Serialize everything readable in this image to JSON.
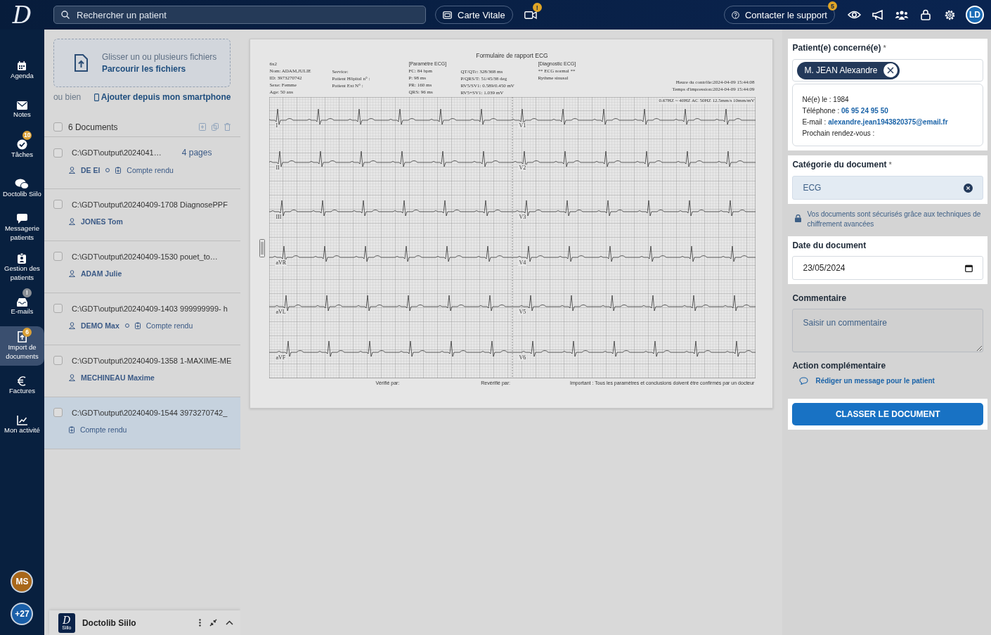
{
  "top_bar": {
    "logo": "D",
    "search": {
      "placeholder": "Rechercher un patient"
    },
    "carte_vitale": "Carte Vitale",
    "video_badge": "!",
    "support": {
      "label": "Contacter le support",
      "badge": "5"
    },
    "avatar": "LD"
  },
  "sidebar": {
    "items": [
      {
        "label": "Agenda",
        "selected": false
      },
      {
        "label": "Notes",
        "selected": false
      },
      {
        "label": "Tâches",
        "badge": "10",
        "selected": false
      },
      {
        "label": "Doctolib Siilo",
        "selected": false
      },
      {
        "label": "Messagerie patients",
        "selected": false
      },
      {
        "label": "Gestion des patients",
        "selected": false
      },
      {
        "label": "E-mails",
        "badge": "!",
        "selected": false
      },
      {
        "label": "Import de documents",
        "badge": "6",
        "selected": true
      },
      {
        "label": "Factures",
        "selected": false
      },
      {
        "label": "Mon activité",
        "selected": false
      }
    ],
    "bottom_avatars": [
      {
        "initials": "MS",
        "color": "#a8671a"
      },
      {
        "initials": "+27",
        "color": "#1a5fa8"
      }
    ]
  },
  "documents_panel": {
    "upload": {
      "text": "Glisser un ou plusieurs fichiers",
      "link": "Parcourir les fichiers"
    },
    "or_text": "ou bien",
    "smartphone_link": "Ajouter depuis mon smartphone",
    "list_header": {
      "count": "6 Documents",
      "checked": false
    },
    "documents": [
      {
        "filename": "C:\\GDT\\output\\2024041…",
        "pages": "4 pages",
        "patient": "DE El",
        "type": "Compte rendu",
        "checked": false,
        "selected": false
      },
      {
        "filename": "C:\\GDT\\output\\20240409-1708 DiagnosePPF",
        "patient": "JONES Tom",
        "checked": false,
        "selected": false
      },
      {
        "filename": "C:\\GDT\\output\\20240409-1530 pouet_to…",
        "patient": "ADAM Julie",
        "checked": false,
        "selected": false
      },
      {
        "filename": "C:\\GDT\\output\\20240409-1403 999999999- h",
        "patient": "DEMO Max",
        "type": "Compte rendu",
        "checked": false,
        "selected": false
      },
      {
        "filename": "C:\\GDT\\output\\20240409-1358 1-MAXIME-ME",
        "patient": "MECHINEAU Maxime",
        "checked": false,
        "selected": false
      },
      {
        "filename": "C:\\GDT\\output\\20240409-1544 3973270742_",
        "type": "Compte rendu",
        "checked": false,
        "selected": true
      }
    ]
  },
  "document_preview": {
    "title": "Formulaire de rapport ECG",
    "header_columns": [
      [
        "6x2",
        "Nom: ADAM,JULIE",
        "ID: 3973270742",
        "Sexe: Femme",
        "Age: 50 ans"
      ],
      [
        "Service:",
        "Patient Hôpital n° :",
        "Patient Ext N° :"
      ],
      [
        "[Paramètre ECG]",
        "FC: 84 bpm",
        "P: 98 ms",
        "PR: 160 ms",
        "QRS: 96 ms"
      ],
      [
        "QT/QTc: 328/368 ms",
        "P/QRS/T: 51/45/38 deg",
        "RV5/SV1: 0.589/0.450 mV",
        "RV5+SV1: 1.039 mV"
      ],
      [
        "[Diagnostic ECG]",
        "** ECG normal **",
        "Rythme sinusal"
      ]
    ],
    "timestamps": [
      "Heure du contrôle:2024-04-09 15:44:08",
      "Temps d'impression:2024-04-09 15:44:09"
    ],
    "filter_settings": "0.67HZ ~ 40HZ AC 50HZ 12.5mm/s 10mm/mV",
    "lead_labels_left": [
      "I",
      "II",
      "III",
      "aVR",
      "aVL",
      "aVF"
    ],
    "lead_labels_right": [
      "V1",
      "V2",
      "V3",
      "V4",
      "V5",
      "V6"
    ],
    "footer": [
      "Vérifié par:",
      "Revérifié par:",
      "Important : Tous les paramètres et conclusions doivent être confirmés par un docteur"
    ]
  },
  "form": {
    "patient": {
      "label": "Patient(e) concerné(e)",
      "required_mark": "*",
      "chip": "M. JEAN Alexandre",
      "info": {
        "born": "Né(e) le : 1984",
        "phone_label": "Téléphone :",
        "phone": "06 95 24 95 50",
        "email_label": "E-mail :",
        "email": "alexandre.jean1943820375@email.fr",
        "next_appointment": "Prochain rendez-vous :"
      }
    },
    "category": {
      "label": "Catégorie du document",
      "required_mark": "*",
      "value": "ECG"
    },
    "security_note": "Vos documents sont sécurisés grâce aux techniques de chiffrement avancées",
    "date": {
      "label": "Date du document",
      "value": "23/05/2024"
    },
    "comment": {
      "label": "Commentaire",
      "placeholder": "Saisir un commentaire"
    },
    "action": {
      "label": "Action complémentaire",
      "link": "Rédiger un message pour le patient"
    },
    "submit": "CLASSER LE DOCUMENT"
  },
  "siilo_widget": {
    "logo": "D",
    "logo_caption": "Siilo",
    "title": "Doctolib Siilo"
  }
}
